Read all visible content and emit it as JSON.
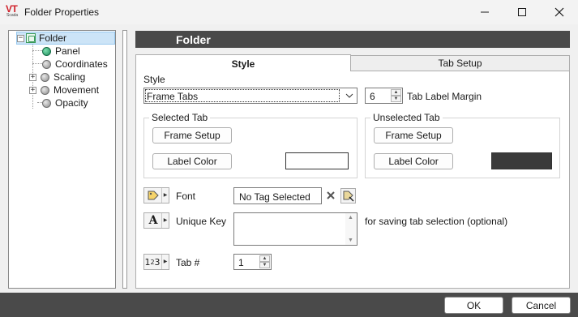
{
  "window": {
    "title": "Folder Properties",
    "logo_text": "VT",
    "logo_subtext": "Scada"
  },
  "tree": {
    "items": [
      {
        "label": "Folder",
        "icon": "folder-icon",
        "expander": "−"
      },
      {
        "label": "Panel",
        "icon": "green-dot-icon"
      },
      {
        "label": "Coordinates",
        "icon": "grey-dot-icon"
      },
      {
        "label": "Scaling",
        "icon": "grey-dot-icon",
        "expander": "+"
      },
      {
        "label": "Movement",
        "icon": "grey-dot-icon",
        "expander": "+"
      },
      {
        "label": "Opacity",
        "icon": "grey-dot-icon"
      }
    ]
  },
  "header": {
    "title": "Folder"
  },
  "tabs": [
    {
      "label": "Style",
      "active": true
    },
    {
      "label": "Tab Setup",
      "active": false
    }
  ],
  "style": {
    "style_label": "Style",
    "style_value": "Frame Tabs",
    "margin_value": "6",
    "margin_label": "Tab Label Margin",
    "selected_tab": {
      "title": "Selected Tab",
      "frame_setup": "Frame Setup",
      "label_color": "Label Color",
      "swatch_color": "#ffffff"
    },
    "unselected_tab": {
      "title": "Unselected Tab",
      "frame_setup": "Frame Setup",
      "label_color": "Label Color",
      "swatch_color": "#3a3a3a"
    },
    "font_label": "Font",
    "font_value": "No Tag Selected",
    "unique_key_label": "Unique Key",
    "unique_key_value": "",
    "unique_key_hint": "for saving tab selection (optional)",
    "tab_num_label": "Tab #",
    "tab_num_value": "1"
  },
  "footer": {
    "ok_label": "OK",
    "cancel_label": "Cancel"
  },
  "colors": {
    "header_bg": "#4a4a4a",
    "selection": "#cce4f7"
  }
}
